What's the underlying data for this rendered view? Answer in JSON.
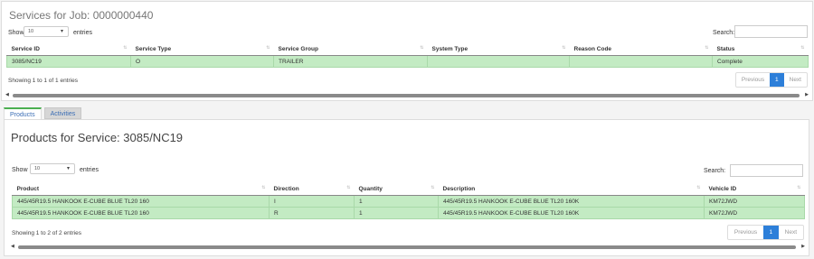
{
  "jobs_panel": {
    "title": "Services for Job: 0000000440",
    "show_label": "Show",
    "entries_label": "entries",
    "page_length": "10",
    "search_label": "Search:",
    "columns": [
      "Service ID",
      "Service Type",
      "Service Group",
      "System Type",
      "Reason Code",
      "Status"
    ],
    "rows": [
      [
        "3085/NC19",
        "O",
        "TRAILER",
        "",
        "",
        "Complete"
      ]
    ],
    "info": "Showing 1 to 1 of 1 entries",
    "pager": {
      "previous": "Previous",
      "page": "1",
      "next": "Next"
    }
  },
  "tabs": [
    {
      "label": "Products",
      "active": true
    },
    {
      "label": "Activities",
      "active": false
    }
  ],
  "products_panel": {
    "title": "Products for Service: 3085/NC19",
    "show_label": "Show",
    "entries_label": "entries",
    "page_length": "10",
    "search_label": "Search:",
    "columns": [
      "Product",
      "Direction",
      "Quantity",
      "Description",
      "Vehicle ID"
    ],
    "rows": [
      [
        "445/45R19.5 HANKOOK E-CUBE BLUE TL20 160",
        "I",
        "1",
        "445/45R19.5 HANKOOK E-CUBE BLUE TL20 160K",
        "KM72JWD"
      ],
      [
        "445/45R19.5 HANKOOK E-CUBE BLUE TL20 160",
        "R",
        "1",
        "445/45R19.5 HANKOOK E-CUBE BLUE TL20 160K",
        "KM72JWD"
      ]
    ],
    "info": "Showing 1 to 2 of 2 entries",
    "pager": {
      "previous": "Previous",
      "page": "1",
      "next": "Next"
    }
  },
  "colors": {
    "row_green": "#c3ebc3",
    "active_page": "#2d7fd9",
    "active_tab_accent": "#4caf50",
    "link_blue": "#3a6db5"
  }
}
